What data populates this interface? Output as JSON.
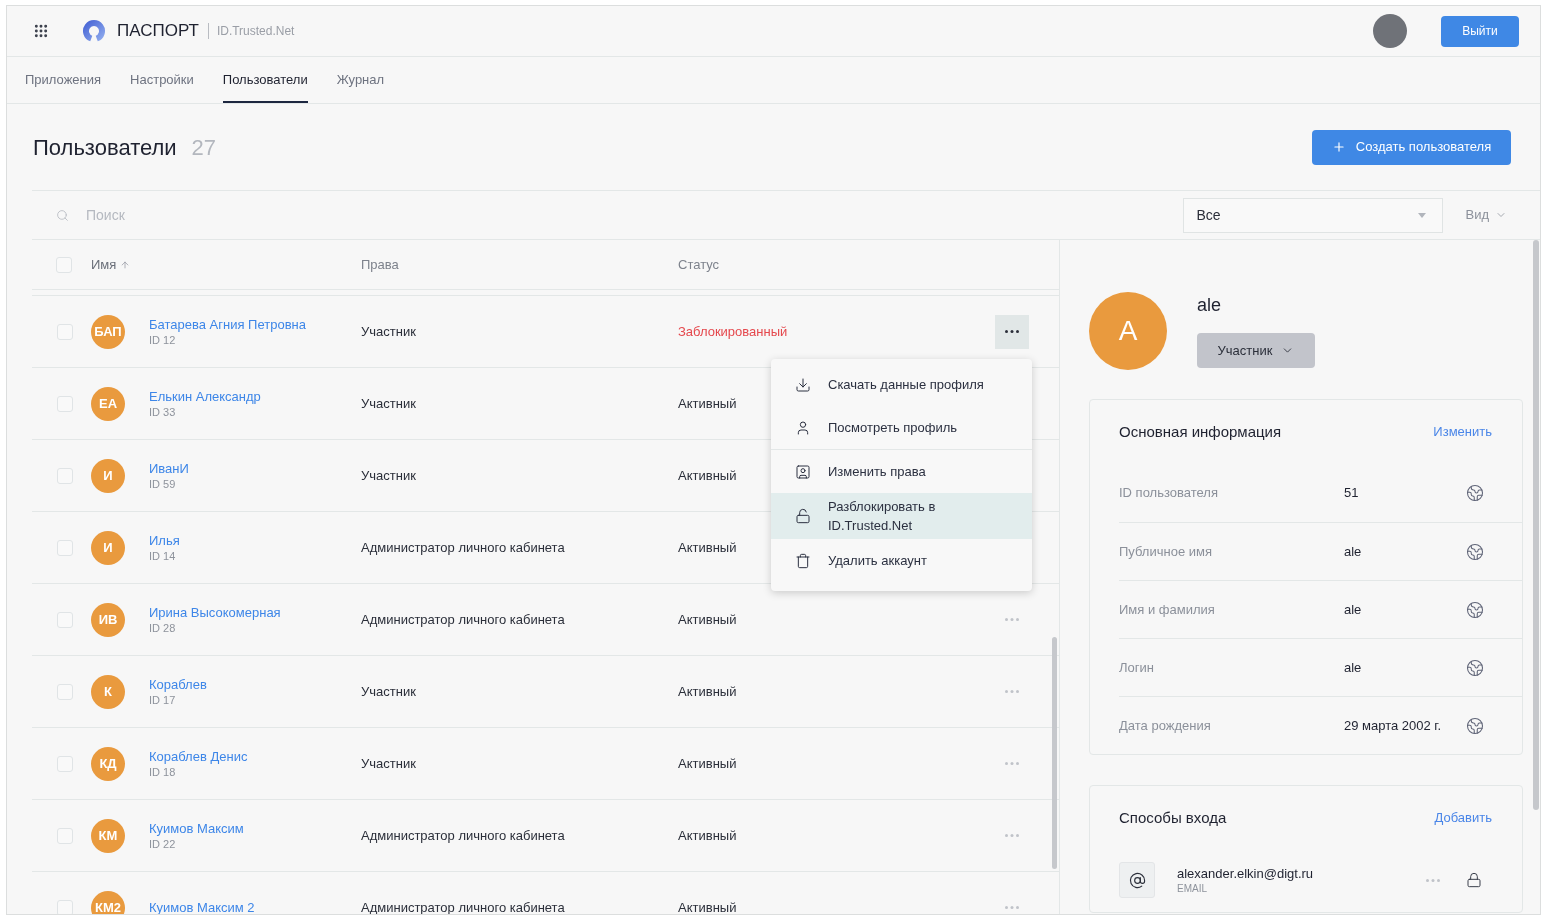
{
  "header": {
    "brand": "ПАСПОРТ",
    "subbrand": "ID.Trusted.Net",
    "logout_button": "Выйти"
  },
  "tabs": [
    {
      "label": "Приложения",
      "selected": false
    },
    {
      "label": "Настройки",
      "selected": false
    },
    {
      "label": "Пользователи",
      "selected": true
    },
    {
      "label": "Журнал",
      "selected": false
    }
  ],
  "page": {
    "title": "Пользователи",
    "count": "27",
    "create_button": "Создать пользователя"
  },
  "filters": {
    "search": {
      "placeholder": "Поиск"
    },
    "status_select": {
      "value": "Все"
    },
    "view_button": "Вид"
  },
  "table": {
    "select_all": {
      "checked": false
    },
    "columns": [
      {
        "label": "Имя",
        "sorted": true
      },
      {
        "label": "Права",
        "sorted": false
      },
      {
        "label": "Статус",
        "sorted": false
      }
    ],
    "rows": [
      {
        "initials": "БАП",
        "name": "Батарева Агния Петровна",
        "id": "ID 12",
        "rights": "Участник",
        "status": "Заблокированный",
        "blocked": true,
        "checked": false,
        "menu_open": true
      },
      {
        "initials": "ЕА",
        "name": "Елькин Александр",
        "id": "ID 33",
        "rights": "Участник",
        "status": "Активный",
        "blocked": false,
        "checked": false
      },
      {
        "initials": "И",
        "name": "ИванИ",
        "id": "ID 59",
        "rights": "Участник",
        "status": "Активный",
        "blocked": false,
        "checked": false
      },
      {
        "initials": "И",
        "name": "Илья",
        "id": "ID 14",
        "rights": "Администратор личного кабинета",
        "status": "Активный",
        "blocked": false,
        "checked": false
      },
      {
        "initials": "ИВ",
        "name": "Ирина Высокомерная",
        "id": "ID 28",
        "rights": "Администратор личного кабинета",
        "status": "Активный",
        "blocked": false,
        "checked": false,
        "menu_open": false
      },
      {
        "initials": "К",
        "name": "Кораблев",
        "id": "ID 17",
        "rights": "Участник",
        "status": "Активный",
        "blocked": false,
        "checked": false,
        "menu_open": false
      },
      {
        "initials": "КД",
        "name": "Кораблев Денис",
        "id": "ID 18",
        "rights": "Участник",
        "status": "Активный",
        "blocked": false,
        "checked": false,
        "menu_open": false
      },
      {
        "initials": "КМ",
        "name": "Куимов Максим",
        "id": "ID 22",
        "rights": "Администратор личного кабинета",
        "status": "Активный",
        "blocked": false,
        "checked": false,
        "menu_open": false
      },
      {
        "initials": "КМ2",
        "name": "Куимов Максим 2",
        "rights": "Администратор личного кабинета",
        "status": "Активный",
        "blocked": false,
        "checked": false,
        "menu_open": false
      }
    ]
  },
  "row_menu": {
    "groups": [
      {
        "items": [
          {
            "kind": "download",
            "label": "Скачать данные профиля",
            "highlighted": false
          },
          {
            "kind": "profile",
            "label": "Посмотреть профиль",
            "highlighted": false
          }
        ]
      },
      {
        "items": [
          {
            "kind": "rights",
            "label": "Изменить права",
            "highlighted": false
          },
          {
            "kind": "unlock",
            "label": "Разблокировать в ID.Trusted.Net",
            "highlighted": true
          },
          {
            "kind": "delete",
            "label": "Удалить аккаунт",
            "highlighted": false
          }
        ]
      }
    ]
  },
  "profile": {
    "initial": "A",
    "name": "ale",
    "role_button": "Участник",
    "info_card": {
      "title": "Основная информация",
      "action": "Изменить",
      "fields": [
        {
          "label": "ID пользователя",
          "value": "51"
        },
        {
          "label": "Публичное имя",
          "value": "ale"
        },
        {
          "label": "Имя и фамилия",
          "value": "ale"
        },
        {
          "label": "Логин",
          "value": "ale"
        },
        {
          "label": "Дата рождения",
          "value": "29 марта 2002 г."
        }
      ]
    },
    "login_card": {
      "title": "Способы входа",
      "action": "Добавить",
      "methods": [
        {
          "kind": "email",
          "value": "alexander.elkin@digt.ru",
          "type_label": "EMAIL"
        }
      ]
    }
  }
}
